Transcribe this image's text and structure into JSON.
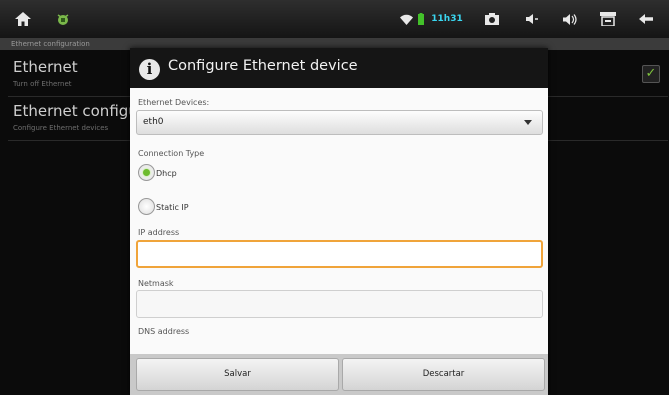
{
  "status_bar": {
    "time": "11h31",
    "icons": [
      "home-icon",
      "android-debug-icon",
      "wifi-icon",
      "battery-icon",
      "screenshot-icon",
      "volume-down-icon",
      "volume-up-icon",
      "menu-icon",
      "back-icon"
    ]
  },
  "background": {
    "subtitle": "Ethernet configuration",
    "items": [
      {
        "title": "Ethernet",
        "summary": "Turn off Ethernet"
      },
      {
        "title": "Ethernet configur",
        "summary": "Configure Ethernet devices"
      }
    ],
    "ethernet_enabled": true
  },
  "dialog": {
    "title": "Configure Ethernet device",
    "devices_label": "Ethernet Devices:",
    "device_selected": "eth0",
    "connection_type_label": "Connection Type",
    "options": [
      {
        "label": "Dhcp",
        "selected": true
      },
      {
        "label": "Static IP",
        "selected": false
      }
    ],
    "ip_label": "IP address",
    "ip_value": "",
    "netmask_label": "Netmask",
    "netmask_value": "",
    "dns_label": "DNS address",
    "save_label": "Salvar",
    "discard_label": "Descartar"
  },
  "colors": {
    "focus": "#f0a43a",
    "radio_selected": "#6dbb2d",
    "check": "#7ec23c"
  }
}
